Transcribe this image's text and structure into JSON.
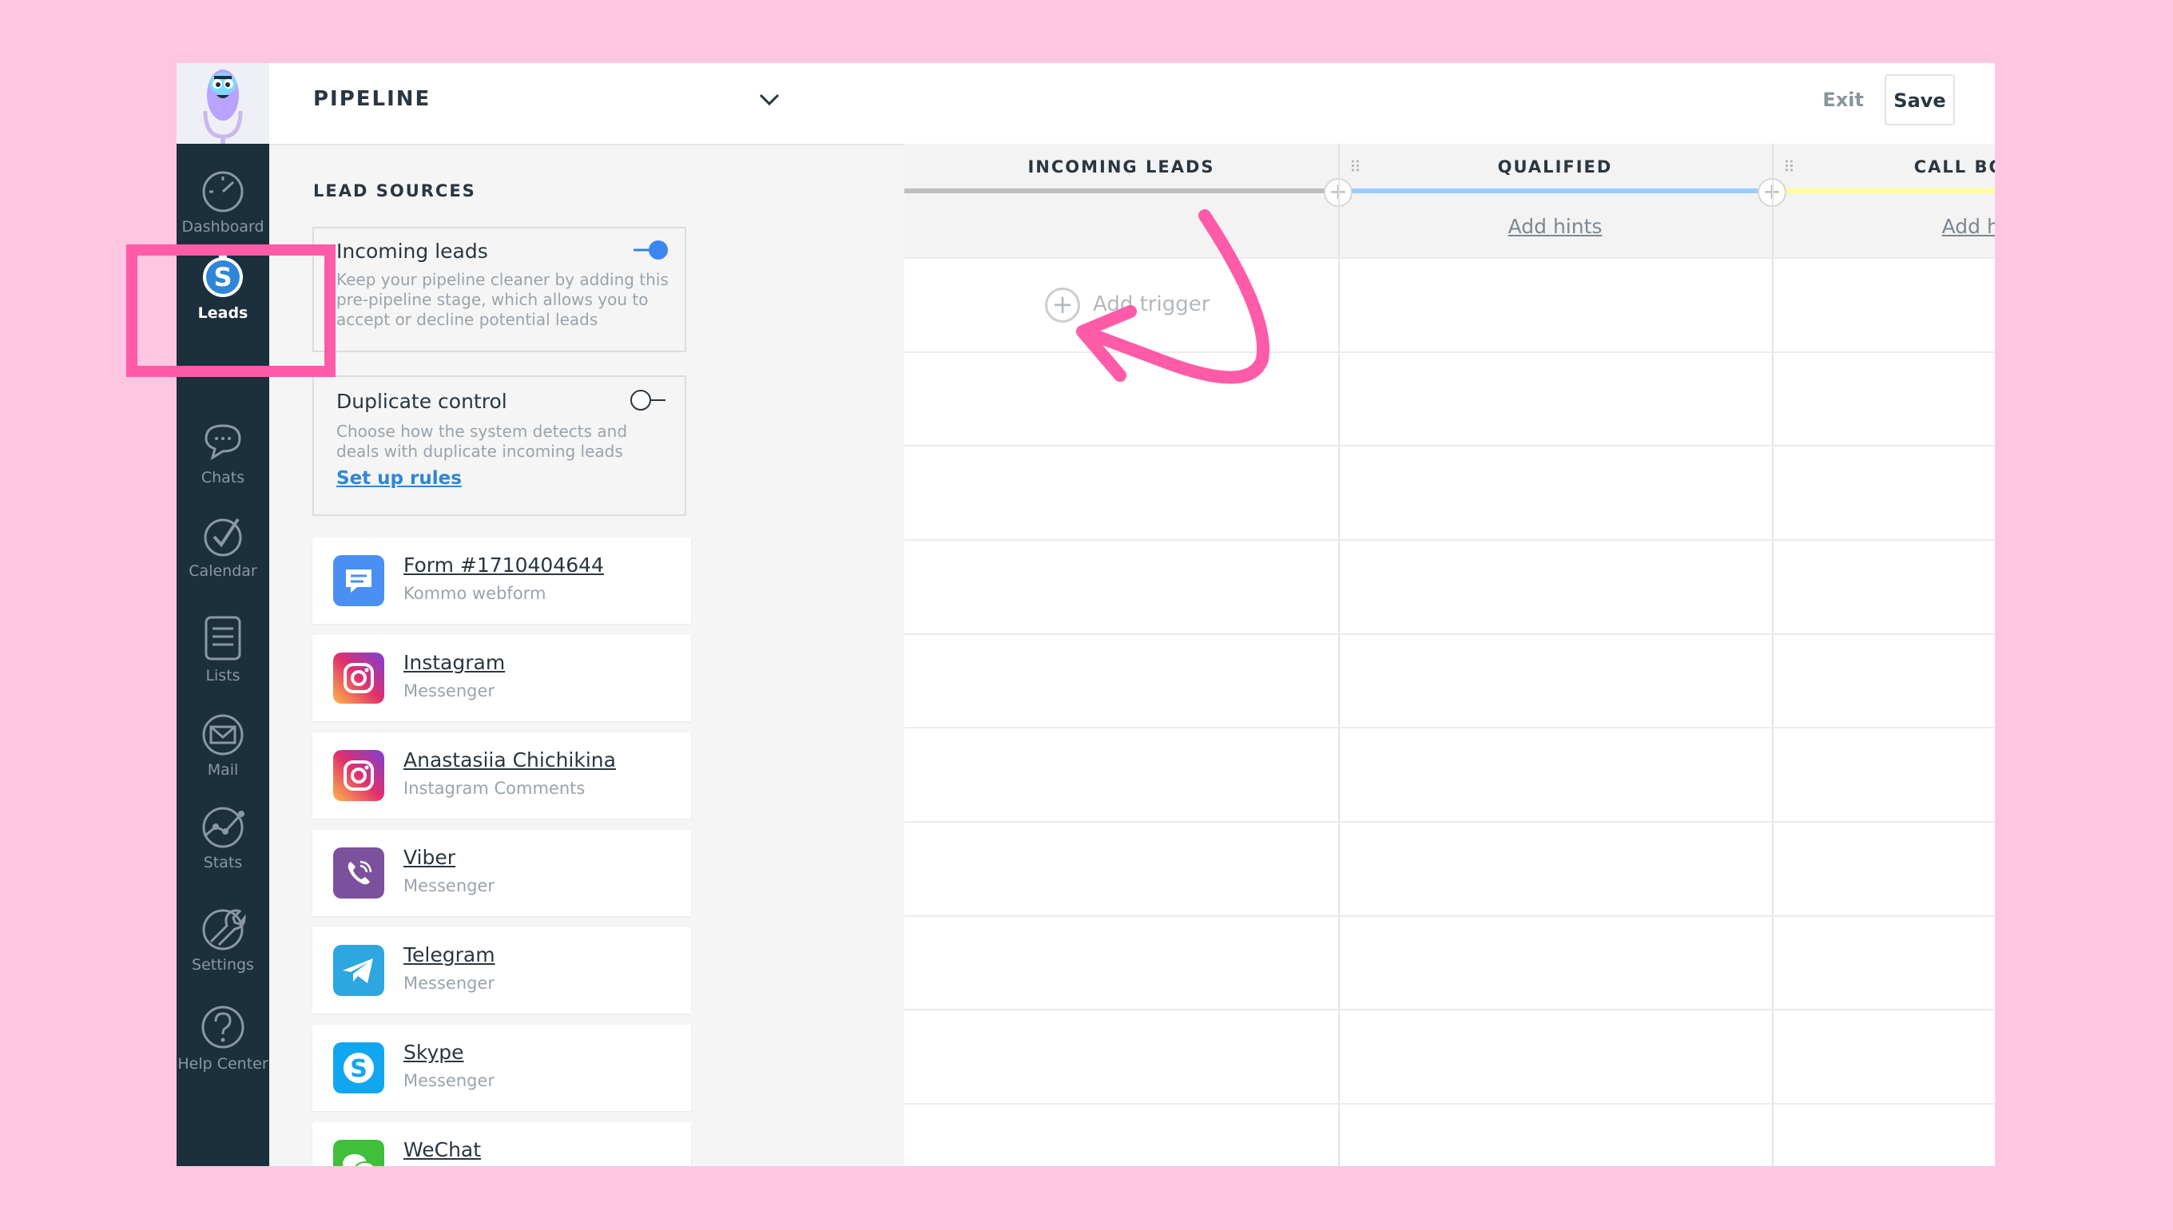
{
  "rail": {
    "items": [
      {
        "label": "Dashboard"
      },
      {
        "label": "Leads"
      },
      {
        "label": "Chats"
      },
      {
        "label": "Calendar"
      },
      {
        "label": "Lists"
      },
      {
        "label": "Mail"
      },
      {
        "label": "Stats"
      },
      {
        "label": "Settings"
      },
      {
        "label": "Help Center"
      }
    ],
    "active": "Leads"
  },
  "sidebar": {
    "title": "PIPELINE",
    "section_title": "LEAD SOURCES",
    "incoming": {
      "title": "Incoming leads",
      "description": "Keep your pipeline cleaner by adding this pre-pipeline stage, which allows you to accept or decline potential leads",
      "enabled": true
    },
    "duplicate": {
      "title": "Duplicate control",
      "description": "Choose how the system detects and deals with duplicate incoming leads",
      "link": "Set up rules",
      "enabled": false
    },
    "sources": [
      {
        "name": "Form #1710404644",
        "type": "Kommo webform",
        "icon": "form-icon"
      },
      {
        "name": "Instagram",
        "type": "Messenger",
        "icon": "instagram-icon"
      },
      {
        "name": "Anastasiia Chichikina",
        "type": "Instagram Comments",
        "icon": "instagram-icon"
      },
      {
        "name": "Viber",
        "type": "Messenger",
        "icon": "viber-icon"
      },
      {
        "name": "Telegram",
        "type": "Messenger",
        "icon": "telegram-icon"
      },
      {
        "name": "Skype",
        "type": "Messenger",
        "icon": "skype-icon"
      },
      {
        "name": "WeChat",
        "type": "",
        "icon": "wechat-icon"
      }
    ]
  },
  "header": {
    "exit_label": "Exit",
    "save_label": "Save"
  },
  "columns": [
    {
      "title": "INCOMING LEADS",
      "color": "#bdbdbd",
      "hints": ""
    },
    {
      "title": "QUALIFIED",
      "color": "#99ccff",
      "hints": "Add hints"
    },
    {
      "title": "CALL BOOKED",
      "color": "#ffff99",
      "hints": "Add hints"
    }
  ],
  "trigger_label": "Add trigger",
  "colors": {
    "rail_bg": "#1b2f3d",
    "accent": "#2f86d9",
    "annotation": "#ff5ba8",
    "page_bg": "#ffc6e2"
  }
}
